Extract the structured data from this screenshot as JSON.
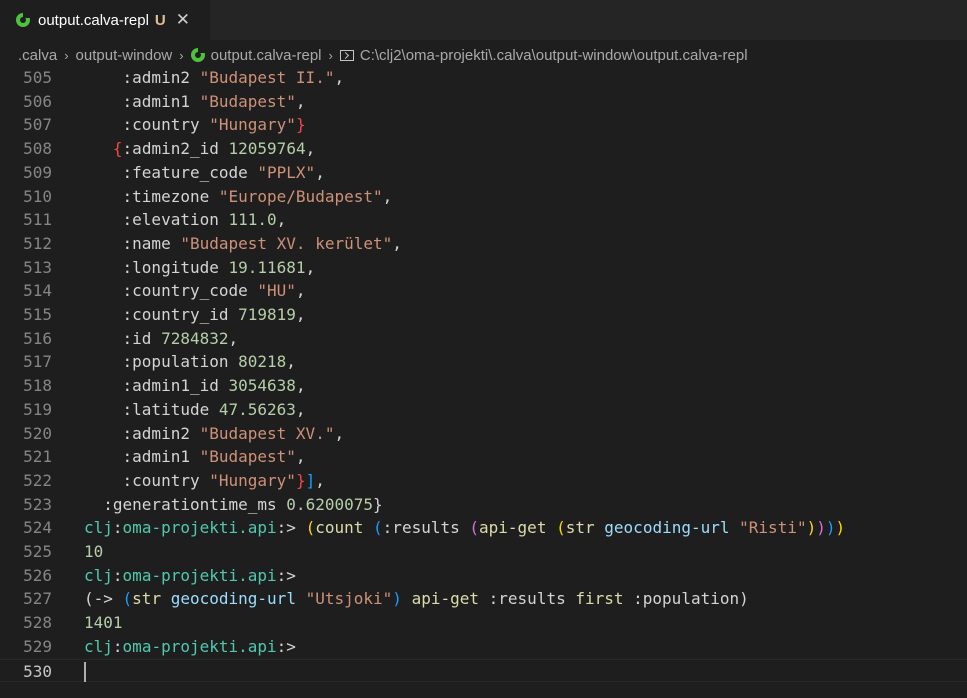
{
  "tab": {
    "title": "output.calva-repl",
    "badge": "U",
    "close": "✕",
    "icon": "calva-icon"
  },
  "breadcrumb": {
    "items": [
      ".calva",
      "output-window",
      "output.calva-repl",
      "C:\\clj2\\oma-projekti\\.calva\\output-window\\output.calva-repl"
    ],
    "separator": "›"
  },
  "editor": {
    "lines": [
      {
        "n": "505",
        "segs": [
          [
            "kw",
            "    :admin2 "
          ],
          [
            "str",
            "\"Budapest II.\""
          ],
          [
            "kw",
            ","
          ]
        ]
      },
      {
        "n": "506",
        "segs": [
          [
            "kw",
            "    :admin1 "
          ],
          [
            "str",
            "\"Budapest\""
          ],
          [
            "kw",
            ","
          ]
        ]
      },
      {
        "n": "507",
        "segs": [
          [
            "kw",
            "    :country "
          ],
          [
            "str",
            "\"Hungary\""
          ],
          [
            "bred",
            "}"
          ]
        ]
      },
      {
        "n": "508",
        "segs": [
          [
            "kw",
            "   "
          ],
          [
            "bred",
            "{"
          ],
          [
            "kw",
            ":admin2_id "
          ],
          [
            "num",
            "12059764"
          ],
          [
            "kw",
            ","
          ]
        ]
      },
      {
        "n": "509",
        "segs": [
          [
            "kw",
            "    :feature_code "
          ],
          [
            "str",
            "\"PPLX\""
          ],
          [
            "kw",
            ","
          ]
        ]
      },
      {
        "n": "510",
        "segs": [
          [
            "kw",
            "    :timezone "
          ],
          [
            "str",
            "\"Europe/Budapest\""
          ],
          [
            "kw",
            ","
          ]
        ]
      },
      {
        "n": "511",
        "segs": [
          [
            "kw",
            "    :elevation "
          ],
          [
            "num",
            "111.0"
          ],
          [
            "kw",
            ","
          ]
        ]
      },
      {
        "n": "512",
        "segs": [
          [
            "kw",
            "    :name "
          ],
          [
            "str",
            "\"Budapest XV. kerület\""
          ],
          [
            "kw",
            ","
          ]
        ]
      },
      {
        "n": "513",
        "segs": [
          [
            "kw",
            "    :longitude "
          ],
          [
            "num",
            "19.11681"
          ],
          [
            "kw",
            ","
          ]
        ]
      },
      {
        "n": "514",
        "segs": [
          [
            "kw",
            "    :country_code "
          ],
          [
            "str",
            "\"HU\""
          ],
          [
            "kw",
            ","
          ]
        ]
      },
      {
        "n": "515",
        "segs": [
          [
            "kw",
            "    :country_id "
          ],
          [
            "num",
            "719819"
          ],
          [
            "kw",
            ","
          ]
        ]
      },
      {
        "n": "516",
        "segs": [
          [
            "kw",
            "    :id "
          ],
          [
            "num",
            "7284832"
          ],
          [
            "kw",
            ","
          ]
        ]
      },
      {
        "n": "517",
        "segs": [
          [
            "kw",
            "    :population "
          ],
          [
            "num",
            "80218"
          ],
          [
            "kw",
            ","
          ]
        ]
      },
      {
        "n": "518",
        "segs": [
          [
            "kw",
            "    :admin1_id "
          ],
          [
            "num",
            "3054638"
          ],
          [
            "kw",
            ","
          ]
        ]
      },
      {
        "n": "519",
        "segs": [
          [
            "kw",
            "    :latitude "
          ],
          [
            "num",
            "47.56263"
          ],
          [
            "kw",
            ","
          ]
        ]
      },
      {
        "n": "520",
        "segs": [
          [
            "kw",
            "    :admin2 "
          ],
          [
            "str",
            "\"Budapest XV.\""
          ],
          [
            "kw",
            ","
          ]
        ]
      },
      {
        "n": "521",
        "segs": [
          [
            "kw",
            "    :admin1 "
          ],
          [
            "str",
            "\"Budapest\""
          ],
          [
            "kw",
            ","
          ]
        ]
      },
      {
        "n": "522",
        "segs": [
          [
            "kw",
            "    :country "
          ],
          [
            "str",
            "\"Hungary\""
          ],
          [
            "bred",
            "}"
          ],
          [
            "b3",
            "]"
          ],
          [
            "kw",
            ","
          ]
        ]
      },
      {
        "n": "523",
        "segs": [
          [
            "kw",
            "  :generationtime_ms "
          ],
          [
            "num",
            "0.6200075"
          ],
          [
            "kw",
            "}"
          ]
        ]
      },
      {
        "n": "524",
        "segs": [
          [
            "ns",
            "clj"
          ],
          [
            "kw",
            ":"
          ],
          [
            "ns",
            "oma-projekti.api"
          ],
          [
            "kw",
            ":> "
          ],
          [
            "b1",
            "("
          ],
          [
            "fn",
            "count"
          ],
          [
            "kw",
            " "
          ],
          [
            "b3",
            "("
          ],
          [
            "kw",
            ":results "
          ],
          [
            "b2",
            "("
          ],
          [
            "fn",
            "api-get"
          ],
          [
            "kw",
            " "
          ],
          [
            "b1",
            "("
          ],
          [
            "fn",
            "str"
          ],
          [
            "kw",
            " "
          ],
          [
            "sym",
            "geocoding-url"
          ],
          [
            "kw",
            " "
          ],
          [
            "str",
            "\"Risti\""
          ],
          [
            "b1",
            ")"
          ],
          [
            "b2",
            ")"
          ],
          [
            "b3",
            ")"
          ],
          [
            "b1",
            ")"
          ]
        ]
      },
      {
        "n": "525",
        "segs": [
          [
            "num",
            "10"
          ]
        ]
      },
      {
        "n": "526",
        "segs": [
          [
            "ns",
            "clj"
          ],
          [
            "kw",
            ":"
          ],
          [
            "ns",
            "oma-projekti.api"
          ],
          [
            "kw",
            ":>"
          ]
        ]
      },
      {
        "n": "527",
        "segs": [
          [
            "kw",
            "(-> "
          ],
          [
            "b3",
            "("
          ],
          [
            "fn",
            "str"
          ],
          [
            "kw",
            " "
          ],
          [
            "sym",
            "geocoding-url"
          ],
          [
            "kw",
            " "
          ],
          [
            "str",
            "\"Utsjoki\""
          ],
          [
            "b3",
            ")"
          ],
          [
            "kw",
            " "
          ],
          [
            "fn",
            "api-get"
          ],
          [
            "kw",
            " :results "
          ],
          [
            "fn",
            "first"
          ],
          [
            "kw",
            " :population)"
          ]
        ]
      },
      {
        "n": "528",
        "segs": [
          [
            "num",
            "1401"
          ]
        ]
      },
      {
        "n": "529",
        "segs": [
          [
            "ns",
            "clj"
          ],
          [
            "kw",
            ":"
          ],
          [
            "ns",
            "oma-projekti.api"
          ],
          [
            "kw",
            ":>"
          ]
        ]
      },
      {
        "n": "530",
        "segs": [],
        "current": true
      }
    ]
  }
}
